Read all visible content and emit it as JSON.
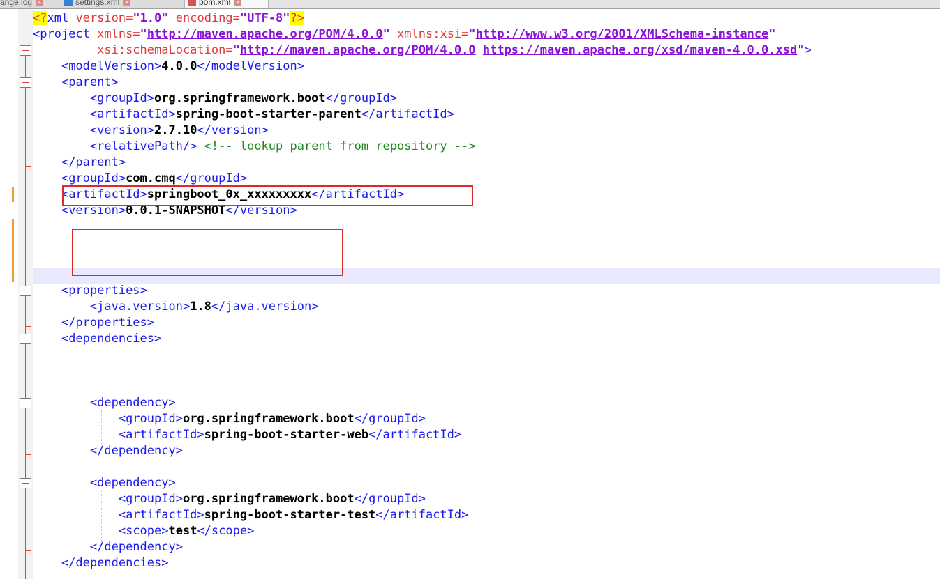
{
  "tabs": [
    {
      "label": "ange.log",
      "active": false
    },
    {
      "label": "settings.xml",
      "active": false
    },
    {
      "label": "pom.xml",
      "active": true
    }
  ],
  "xml": {
    "decl_open": "<?",
    "decl_name": "xml",
    "decl_version_attr": " version=",
    "decl_version_val": "\"1.0\"",
    "decl_encoding_attr": " encoding=",
    "decl_encoding_val": "\"UTF-8\"",
    "decl_close": "?>",
    "project_open": "<project",
    "xmlns_attr": " xmlns=",
    "xmlns_val": "http://maven.apache.org/POM/4.0.0",
    "xmlns_xsi_attr": " xmlns:xsi=",
    "xmlns_xsi_val": "http://www.w3.org/2001/XMLSchema-instance",
    "schema_attr": "xsi:schemaLocation=",
    "schema_val_1": "http://maven.apache.org/POM/4.0.0",
    "schema_val_2": "https://maven.apache.org/xsd/maven-4.0.0.xsd",
    "schema_end": "\">",
    "model_version_open": "<modelVersion>",
    "model_version": "4.0.0",
    "model_version_close": "</modelVersion>",
    "parent_open": "<parent>",
    "parent_group_open": "<groupId>",
    "parent_group": "org.springframework.boot",
    "parent_group_close": "</groupId>",
    "parent_artifact_open": "<artifactId>",
    "parent_artifact": "spring-boot-starter-parent",
    "parent_artifact_close": "</artifactId>",
    "parent_version_open": "<version>",
    "parent_version": "2.7.10",
    "parent_version_close": "</version>",
    "relative_path": "<relativePath/>",
    "relative_comment": "<!-- lookup parent from repository -->",
    "parent_close": "</parent>",
    "group_open": "<groupId>",
    "group": "com.cmq",
    "group_close": "</groupId>",
    "artifact_open": "<artifactId>",
    "artifact": "springboot_0x_xxxxxxxxx",
    "artifact_close": "</artifactId>",
    "version_open": "<version>",
    "version": "0.0.1-SNAPSHOT",
    "version_close": "</version>",
    "properties_open": "<properties>",
    "java_version_open": "<java.version>",
    "java_version": "1.8",
    "java_version_close": "</java.version>",
    "properties_close": "</properties>",
    "dependencies_open": "<dependencies>",
    "dep_open": "<dependency>",
    "dep1_group_open": "<groupId>",
    "dep1_group": "org.springframework.boot",
    "dep1_group_close": "</groupId>",
    "dep1_artifact_open": "<artifactId>",
    "dep1_artifact": "spring-boot-starter-web",
    "dep1_artifact_close": "</artifactId>",
    "dep_close": "</dependency>",
    "dep2_group_open": "<groupId>",
    "dep2_group": "org.springframework.boot",
    "dep2_group_close": "</groupId>",
    "dep2_artifact_open": "<artifactId>",
    "dep2_artifact": "spring-boot-starter-test",
    "dep2_artifact_close": "</artifactId>",
    "scope_open": "<scope>",
    "scope": "test",
    "scope_close": "</scope>",
    "dependencies_close": "</dependencies>"
  },
  "colors": {
    "tag": "#1a1af0",
    "attribute": "#e03a3a",
    "string": "#8a12d6",
    "comment": "#1e8a1e",
    "highlight_box": "#e02828",
    "current_line": "#e8e8ff",
    "change_marker": "#f39c33"
  }
}
